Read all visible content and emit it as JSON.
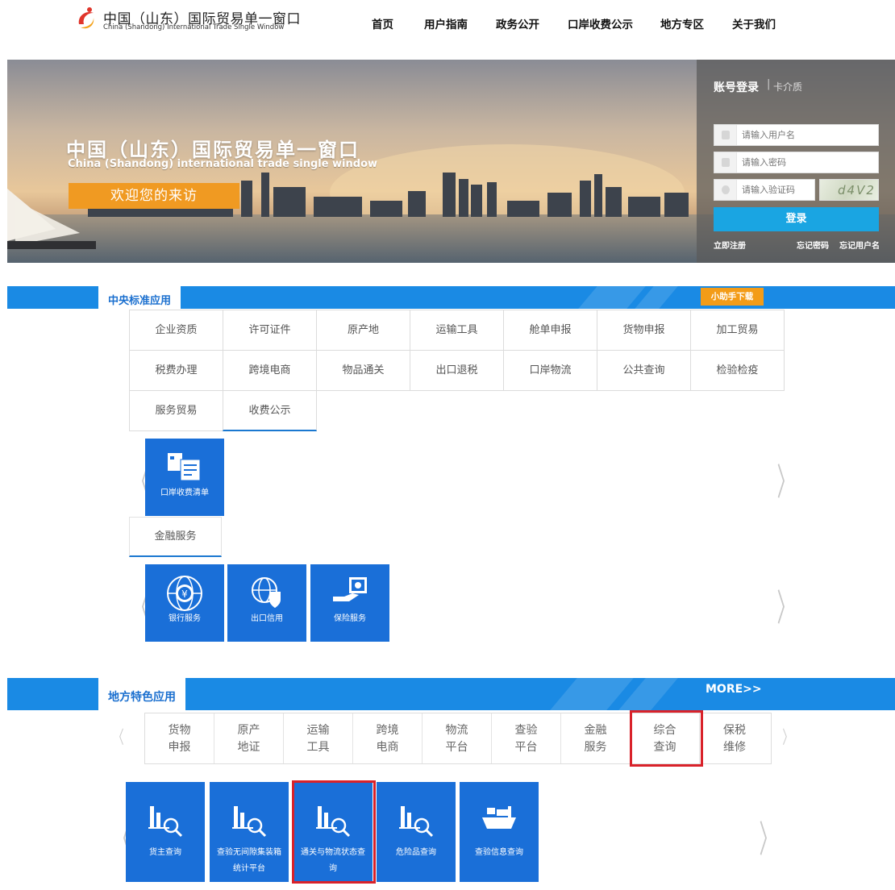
{
  "header": {
    "title": "中国（山东）国际贸易单一窗口",
    "subtitle": "China (Shandong) International Trade Single Window",
    "nav": [
      "首页",
      "用户指南",
      "政务公开",
      "口岸收费公示",
      "地方专区",
      "关于我们"
    ]
  },
  "banner": {
    "title": "中国（山东）国际贸易单一窗口",
    "subtitle": "China (Shandong) international trade single window",
    "welcome": "欢迎您的来访"
  },
  "login": {
    "tab_account": "账号登录",
    "tab_separator": "|",
    "tab_card": "卡介质",
    "username_placeholder": "请输入用户名",
    "password_placeholder": "请输入密码",
    "captcha_placeholder": "请输入验证码",
    "captcha_text": "d4V2",
    "login_button": "登录",
    "register": "立即注册",
    "forgot_password": "忘记密码",
    "forgot_username": "忘记用户名"
  },
  "central": {
    "tab": "中央标准应用",
    "helper_download": "小助手下载",
    "categories_row1": [
      "企业资质",
      "许可证件",
      "原产地",
      "运输工具",
      "舱单申报",
      "货物申报",
      "加工贸易"
    ],
    "categories_row2": [
      "税费办理",
      "跨境电商",
      "物品通关",
      "出口退税",
      "口岸物流",
      "公共查询",
      "检验检疫"
    ],
    "categories_row3": [
      "服务贸易",
      "收费公示"
    ],
    "fee_tiles": [
      "口岸收费清单"
    ],
    "finance_tab": "金融服务",
    "finance_tiles": [
      "银行服务",
      "出口信用",
      "保险服务"
    ]
  },
  "local": {
    "tab": "地方特色应用",
    "more": "MORE>>",
    "categories": [
      {
        "l1": "货物",
        "l2": "申报"
      },
      {
        "l1": "原产",
        "l2": "地证"
      },
      {
        "l1": "运输",
        "l2": "工具"
      },
      {
        "l1": "跨境",
        "l2": "电商"
      },
      {
        "l1": "物流",
        "l2": "平台"
      },
      {
        "l1": "查验",
        "l2": "平台"
      },
      {
        "l1": "金融",
        "l2": "服务"
      },
      {
        "l1": "综合",
        "l2": "查询"
      },
      {
        "l1": "保税",
        "l2": "维修"
      }
    ],
    "tiles": [
      {
        "l1": "货主查询",
        "l2": ""
      },
      {
        "l1": "查验无间隙集装箱",
        "l2": "统计平台"
      },
      {
        "l1": "通关与物流状态查",
        "l2": "询"
      },
      {
        "l1": "危险品查询",
        "l2": ""
      },
      {
        "l1": "查验信息查询",
        "l2": ""
      }
    ]
  },
  "colors": {
    "primary_blue": "#1a8ae4",
    "tile_blue": "#1a6fd8",
    "orange": "#f09a22",
    "highlight_red": "#d9222a"
  }
}
